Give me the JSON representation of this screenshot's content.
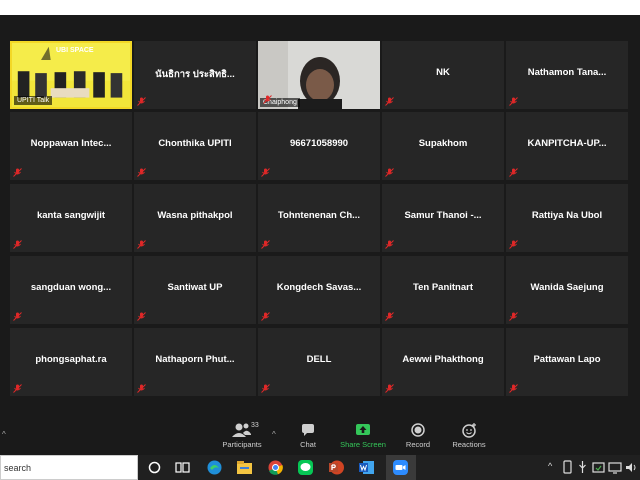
{
  "participants_grid": [
    {
      "name": "",
      "video": true,
      "label": "UPITI Talk",
      "active": true,
      "banner": "UBI SPACE"
    },
    {
      "name": "นันธิการ ประสิทธิ..."
    },
    {
      "name": "",
      "video": true,
      "label": "Chaiphong"
    },
    {
      "name": "NK"
    },
    {
      "name": "Nathamon Tana..."
    },
    {
      "name": "Noppawan Intec..."
    },
    {
      "name": "Chonthika UPITI"
    },
    {
      "name": "96671058990"
    },
    {
      "name": "Supakhom"
    },
    {
      "name": "KANPITCHA-UP..."
    },
    {
      "name": "kanta sangwijit"
    },
    {
      "name": "Wasna pithakpol"
    },
    {
      "name": "Tohntenenan Ch..."
    },
    {
      "name": "Samur Thanoi -..."
    },
    {
      "name": "Rattiya Na Ubol"
    },
    {
      "name": "sangduan wong..."
    },
    {
      "name": "Santiwat UP"
    },
    {
      "name": "Kongdech Savas..."
    },
    {
      "name": "Ten Panitnart"
    },
    {
      "name": "Wanida Saejung"
    },
    {
      "name": "phongsaphat.ra"
    },
    {
      "name": "Nathaporn Phut..."
    },
    {
      "name": "DELL"
    },
    {
      "name": "Aewwi Phakthong"
    },
    {
      "name": "Pattawan Lapo"
    }
  ],
  "toolbar": {
    "participants_label": "Participants",
    "participants_count": "33",
    "chat_label": "Chat",
    "share_label": "Share Screen",
    "record_label": "Record",
    "reactions_label": "Reactions"
  },
  "taskbar": {
    "search_text": "search"
  },
  "colors": {
    "active_border": "#f3d826",
    "share_green": "#34c759",
    "mic_muted": "#e02828"
  }
}
